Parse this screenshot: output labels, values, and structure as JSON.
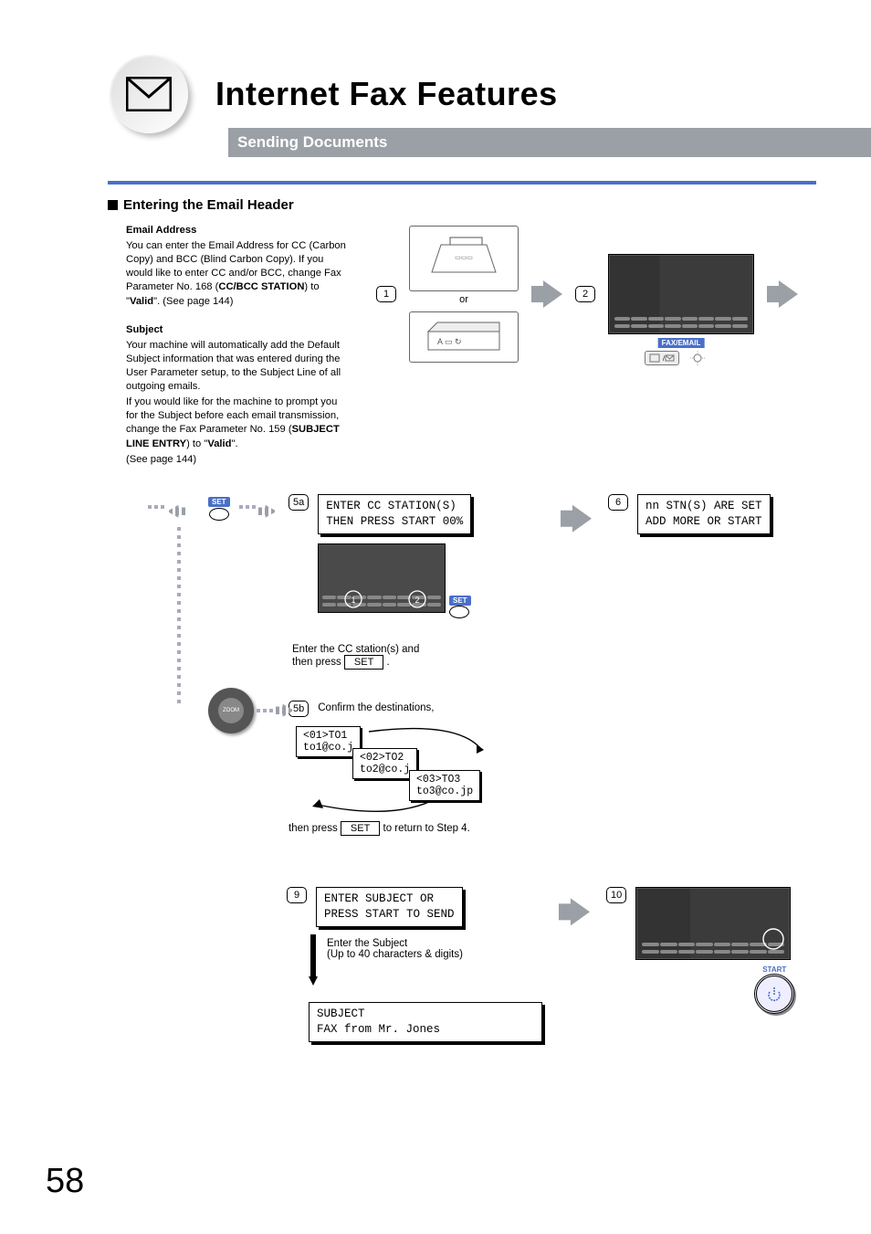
{
  "header": {
    "title": "Internet Fax Features",
    "subtitle": "Sending Documents"
  },
  "section": {
    "title": "Entering the Email Header"
  },
  "left": {
    "email_h": "Email Address",
    "email_p1": "You can enter the Email Address for CC (Carbon Copy) and BCC (Blind Carbon Copy). If you would like to enter CC and/or BCC, change Fax Parameter No. 168 (",
    "email_b1": "CC/BCC STATION",
    "email_p2": ") to \"",
    "email_b2": "Valid",
    "email_p3": "\". (See page 144)",
    "subj_h": "Subject",
    "subj_p1": "Your machine will automatically add the Default Subject information that was entered during the User Parameter setup, to the Subject Line of all outgoing emails.",
    "subj_p2": "If you would like for the machine to prompt you for the Subject before each email transmission, change the Fax Parameter No. 159 (",
    "subj_b1": "SUBJECT LINE ENTRY",
    "subj_p3": ") to \"",
    "subj_b2": "Valid",
    "subj_p4": "\".",
    "subj_p5": " (See page 144)"
  },
  "steps": {
    "s1": "1",
    "s2": "2",
    "s5a": "5a",
    "s5b": "5b",
    "s6": "6",
    "s9": "9",
    "s10": "10"
  },
  "keys": {
    "set": "SET",
    "fax_email": "FAX/EMAIL",
    "start": "START"
  },
  "misc": {
    "or": "or"
  },
  "lcd": {
    "cc1": "ENTER CC STATION(S)",
    "cc2": "THEN PRESS START 00%",
    "stn1": "nn STN(S) ARE SET",
    "stn2": "ADD MORE OR START",
    "subj1": "ENTER SUBJECT OR",
    "subj2": "PRESS START TO SEND",
    "res1": "SUBJECT",
    "res2": "FAX from Mr. Jones"
  },
  "instr": {
    "cc_a": "Enter the CC station(s) and",
    "cc_b": "then press ",
    "cc_c": ".",
    "confirm": "Confirm the destinations,",
    "ret_a": "then press ",
    "ret_b": " to return to Step 4.",
    "subj_a": "Enter the Subject",
    "subj_b": "(Up to 40 characters & digits)"
  },
  "dest": {
    "d1a": "<01>TO1",
    "d1b": "to1@co.j",
    "d2a": "<02>TO2",
    "d2b": "to2@co.j",
    "d3a": "<03>TO3",
    "d3b": "to3@co.jp"
  },
  "page_number": "58"
}
